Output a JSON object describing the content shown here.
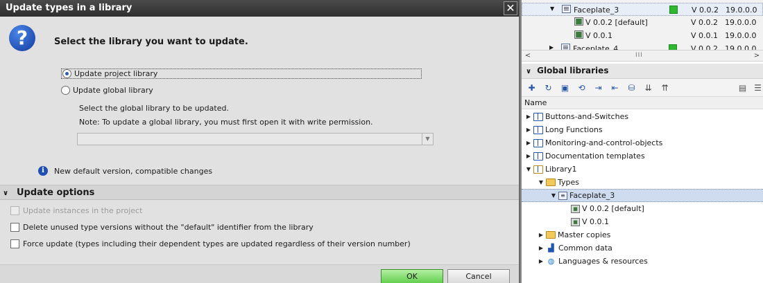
{
  "dialog": {
    "title": "Update types in a library",
    "close_glyph": "✕",
    "question_icon": "question-icon",
    "question": "Select the library you want to update.",
    "radios": [
      {
        "label": "Update project library",
        "selected": true
      },
      {
        "label": "Update global library",
        "selected": false
      }
    ],
    "select_note": "Select the global library to be updated.",
    "permission_note": "Note: To update a global library, you must first open it with write permission.",
    "library_combo_value": "",
    "info_text": "New default version, compatible changes",
    "options_header": "Update options",
    "options": [
      {
        "label": "Update instances in the project",
        "checked": false,
        "disabled": true
      },
      {
        "label": "Delete unused type versions without the \"default\" identifier from the library",
        "checked": false,
        "disabled": false
      },
      {
        "label": "Force update (types including their dependent types are updated regardless of their version number)",
        "checked": false,
        "disabled": false
      }
    ],
    "ok_label": "OK",
    "cancel_label": "Cancel"
  },
  "project_tree": {
    "rows": [
      {
        "name": "Faceplate_3",
        "version": "V 0.0.2",
        "tia_version": "19.0.0.0",
        "status_color": "#2fb82f"
      },
      {
        "name": "V 0.0.2 [default]",
        "version": "V 0.0.2",
        "tia_version": "19.0.0.0"
      },
      {
        "name": "V 0.0.1",
        "version": "V 0.0.1",
        "tia_version": "19.0.0.0"
      },
      {
        "name": "Faceplate_4",
        "version": "V 0.0.2",
        "tia_version": "19.0.0.0",
        "status_color": "#2fb82f"
      }
    ],
    "scroll_grip": "III"
  },
  "global_libraries": {
    "title": "Global libraries",
    "column_name": "Name",
    "toolbar_icons": [
      "new-library-icon",
      "open-library-icon",
      "save-library-icon",
      "update-icon",
      "export-icon",
      "import-icon",
      "database-icon",
      "sort-desc-icon",
      "sort-asc-icon",
      "details-view-icon",
      "list-view-icon"
    ],
    "items": [
      {
        "label": "Buttons-and-Switches",
        "level": 0,
        "icon": "book",
        "expanded": false
      },
      {
        "label": "Long Functions",
        "level": 0,
        "icon": "book",
        "expanded": false
      },
      {
        "label": "Monitoring-and-control-objects",
        "level": 0,
        "icon": "book",
        "expanded": false
      },
      {
        "label": "Documentation templates",
        "level": 0,
        "icon": "book",
        "expanded": false
      },
      {
        "label": "Library1",
        "level": 0,
        "icon": "book-open",
        "expanded": true
      },
      {
        "label": "Types",
        "level": 1,
        "icon": "folder",
        "expanded": true
      },
      {
        "label": "Faceplate_3",
        "level": 2,
        "icon": "type",
        "expanded": true,
        "selected": true
      },
      {
        "label": "V 0.0.2 [default]",
        "level": 3,
        "icon": "version"
      },
      {
        "label": "V 0.0.1",
        "level": 3,
        "icon": "version"
      },
      {
        "label": "Master copies",
        "level": 1,
        "icon": "folder",
        "expanded": false
      },
      {
        "label": "Common data",
        "level": 1,
        "icon": "common",
        "expanded": false
      },
      {
        "label": "Languages & resources",
        "level": 1,
        "icon": "globe",
        "expanded": false
      }
    ]
  }
}
